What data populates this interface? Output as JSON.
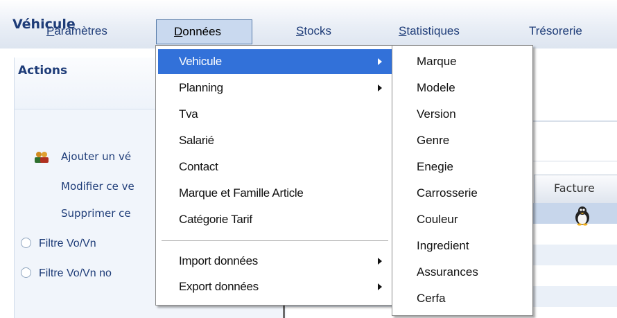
{
  "menubar": {
    "items": [
      {
        "label_ul": "P",
        "label_rest": "aramètres"
      },
      {
        "label_ul": "D",
        "label_rest": "onnées"
      },
      {
        "label_ul": "S",
        "label_rest": "tocks"
      },
      {
        "label_ul": "S",
        "label_rest": "tatistiques"
      },
      {
        "label_ul": "",
        "label_rest": "Trésorerie"
      }
    ]
  },
  "left_pane": {
    "title": "Véhicule",
    "actions_title": "Actions",
    "actions": [
      "Ajouter un vé",
      "Modifier ce ve",
      "Supprimer ce "
    ],
    "filters": [
      "Filtre Vo/Vn",
      "Filtre Vo/Vn no"
    ]
  },
  "grid": {
    "column_header": "Facture"
  },
  "donnees_menu": {
    "items": [
      "Vehicule",
      "Planning",
      "Tva",
      "Salarié",
      "Contact",
      "Marque et Famille Article",
      "Catégorie Tarif"
    ],
    "items_bottom": [
      "Import données",
      "Export données"
    ]
  },
  "vehicule_submenu": {
    "items": [
      "Marque",
      "Modele",
      "Version",
      "Genre",
      "Enegie",
      "Carrosserie",
      "Couleur",
      "Ingredient",
      "Assurances",
      "Cerfa"
    ]
  },
  "colors": {
    "highlight": "#3271d9",
    "menu_text": "#1e3c78",
    "selected_row": "#c7d6eb"
  }
}
